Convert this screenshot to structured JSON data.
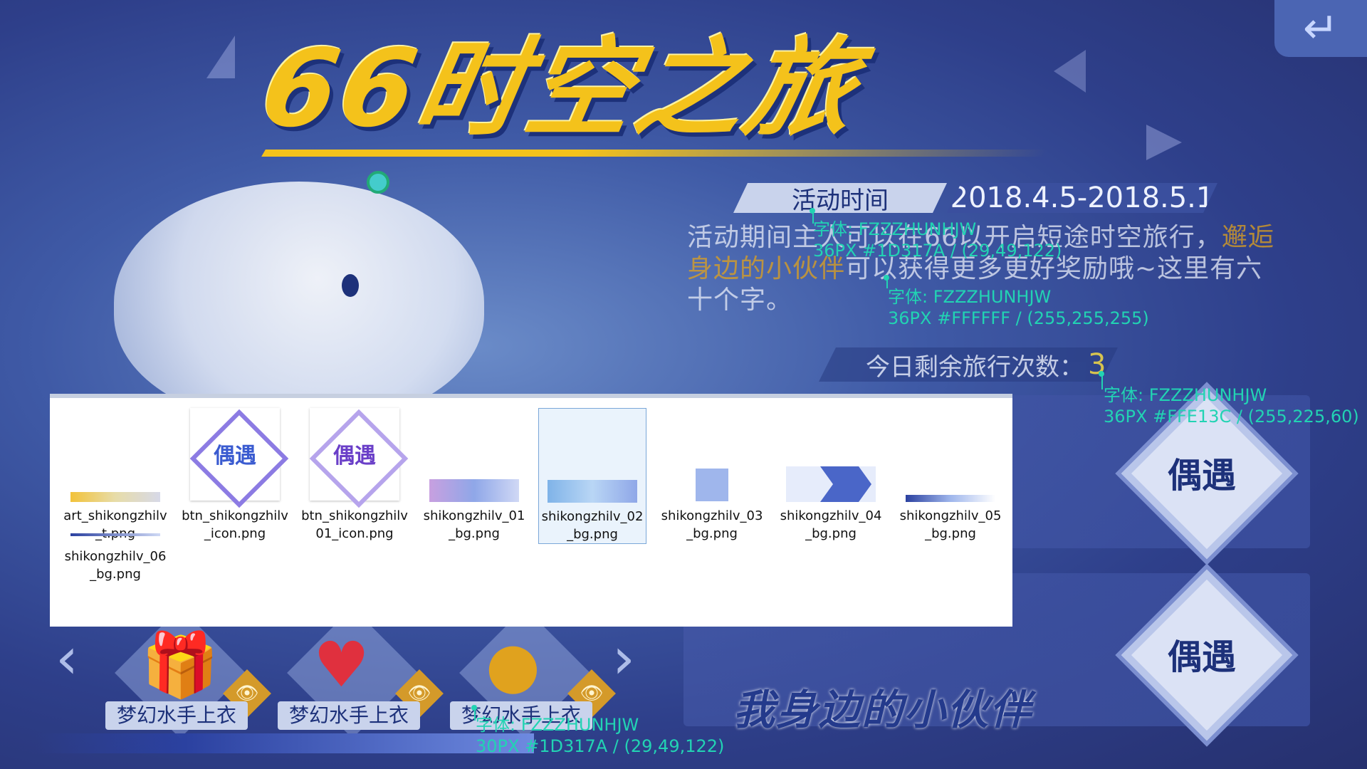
{
  "title": "66时空之旅",
  "return_icon": "return-arrow-icon",
  "activity_time": {
    "label": "活动时间",
    "value": "2018.4.5-2018.5.1"
  },
  "description": {
    "part1": "活动期间主人可以在66以开启短途时空旅行，",
    "highlight": "邂逅身边的小伙伴",
    "part2": "可以获得更多更好奖励哦~这里有六十个字。"
  },
  "remaining": {
    "label": "今日剩余旅行次数：",
    "count": "3"
  },
  "annotations": [
    {
      "line1": "字体: FZZZHUNHJW",
      "line2": "36PX #1D317A / (29,49,122)"
    },
    {
      "line1": "字体: FZZZHUNHJW",
      "line2": "36PX #FFFFFF / (255,255,255)"
    },
    {
      "line1": "字体: FZZZHUNHJW",
      "line2": "36PX #FFE13C / (255,225,60)"
    },
    {
      "line1": "字体: FZZZHUNHJW",
      "line2": "30PX #1D317A / (29,49,122)"
    }
  ],
  "encounter_buttons": [
    "偶遇",
    "偶遇"
  ],
  "banner_text": "我身边的小伙伴",
  "gifts": [
    {
      "label": "梦幻水手上衣",
      "icon": "gift-box-icon"
    },
    {
      "label": "梦幻水手上衣",
      "icon": "heart-icon"
    },
    {
      "label": "梦幻水手上衣",
      "icon": "gold-coin-icon"
    }
  ],
  "files": [
    {
      "name": "art_shikongzhilv_t.png"
    },
    {
      "name": "btn_shikongzhilv_icon.png",
      "thumb_text": "偶遇"
    },
    {
      "name": "btn_shikongzhilv01_icon.png",
      "thumb_text": "偶遇"
    },
    {
      "name": "shikongzhilv_01_bg.png"
    },
    {
      "name": "shikongzhilv_02_bg.png",
      "selected": true
    },
    {
      "name": "shikongzhilv_03_bg.png"
    },
    {
      "name": "shikongzhilv_04_bg.png"
    },
    {
      "name": "shikongzhilv_05_bg.png"
    },
    {
      "name": "shikongzhilv_06_bg.png"
    }
  ],
  "colors": {
    "annotation": "#22D3B3",
    "dark_blue": "#1D317A",
    "yellow": "#FFE13C",
    "title_gold": "#F4C21B"
  }
}
